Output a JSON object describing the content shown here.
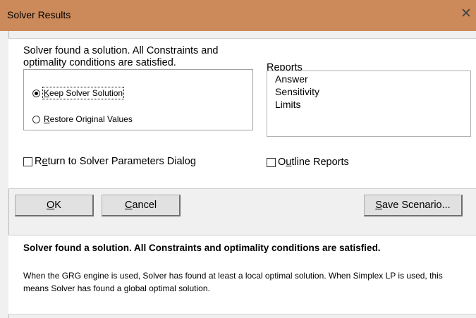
{
  "window": {
    "title": "Solver Results",
    "close_glyph": "✕"
  },
  "result": {
    "message_line1": "Solver found a solution.  All Constraints and",
    "message_line2": "optimality conditions are satisfied."
  },
  "options": {
    "keep": {
      "prefix": "",
      "accel": "K",
      "rest": "eep Solver Solution",
      "selected": true
    },
    "restore": {
      "prefix": "",
      "accel": "R",
      "rest": "estore Original Values",
      "selected": false
    }
  },
  "reports": {
    "label_prefix": "Re",
    "label_accel": "p",
    "label_rest": "orts",
    "items": [
      "Answer",
      "Sensitivity",
      "Limits"
    ]
  },
  "checkboxes": {
    "return_dialog": {
      "prefix": "R",
      "accel": "e",
      "rest": "turn to Solver Parameters Dialog",
      "checked": false
    },
    "outline_reports": {
      "prefix": "O",
      "accel": "u",
      "rest": "tline Reports",
      "checked": false
    }
  },
  "buttons": {
    "ok": {
      "accel": "O",
      "rest": "K"
    },
    "cancel": {
      "accel": "C",
      "rest": "ancel"
    },
    "save_scenario": {
      "accel": "S",
      "rest": "ave Scenario..."
    }
  },
  "details": {
    "heading": "Solver found a solution.  All Constraints and optimality conditions are satisfied.",
    "body_line1": "When the GRG engine is used, Solver has found at least a local optimal solution. When Simplex LP is used, this",
    "body_line2": "means Solver has found a global optimal solution."
  }
}
